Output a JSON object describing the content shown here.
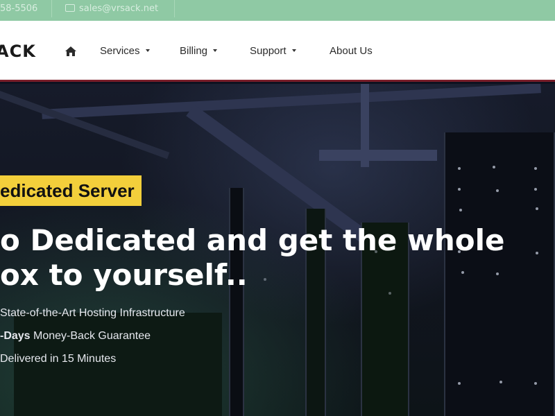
{
  "topbar": {
    "phone": "58-5506",
    "email": "sales@vrsack.net"
  },
  "nav": {
    "logo": "ACK",
    "home_icon": "home-icon",
    "items": [
      {
        "label": "Services",
        "dropdown": true
      },
      {
        "label": "Billing",
        "dropdown": true
      },
      {
        "label": "Support",
        "dropdown": true
      },
      {
        "label": "About Us",
        "dropdown": false
      }
    ]
  },
  "hero": {
    "badge": "edicated Server",
    "headline_line1": "o Dedicated and get the whole",
    "headline_line2": "ox to yourself..",
    "features": [
      {
        "bold": "",
        "text": "State-of-the-Art Hosting Infrastructure"
      },
      {
        "bold": "-Days",
        "text": " Money-Back Guarantee"
      },
      {
        "bold": "",
        "text": "Delivered in 15 Minutes"
      }
    ]
  },
  "colors": {
    "topbar": "#8fc9a4",
    "badge": "#f3cf3b",
    "nav_border": "#7a1e2a"
  }
}
